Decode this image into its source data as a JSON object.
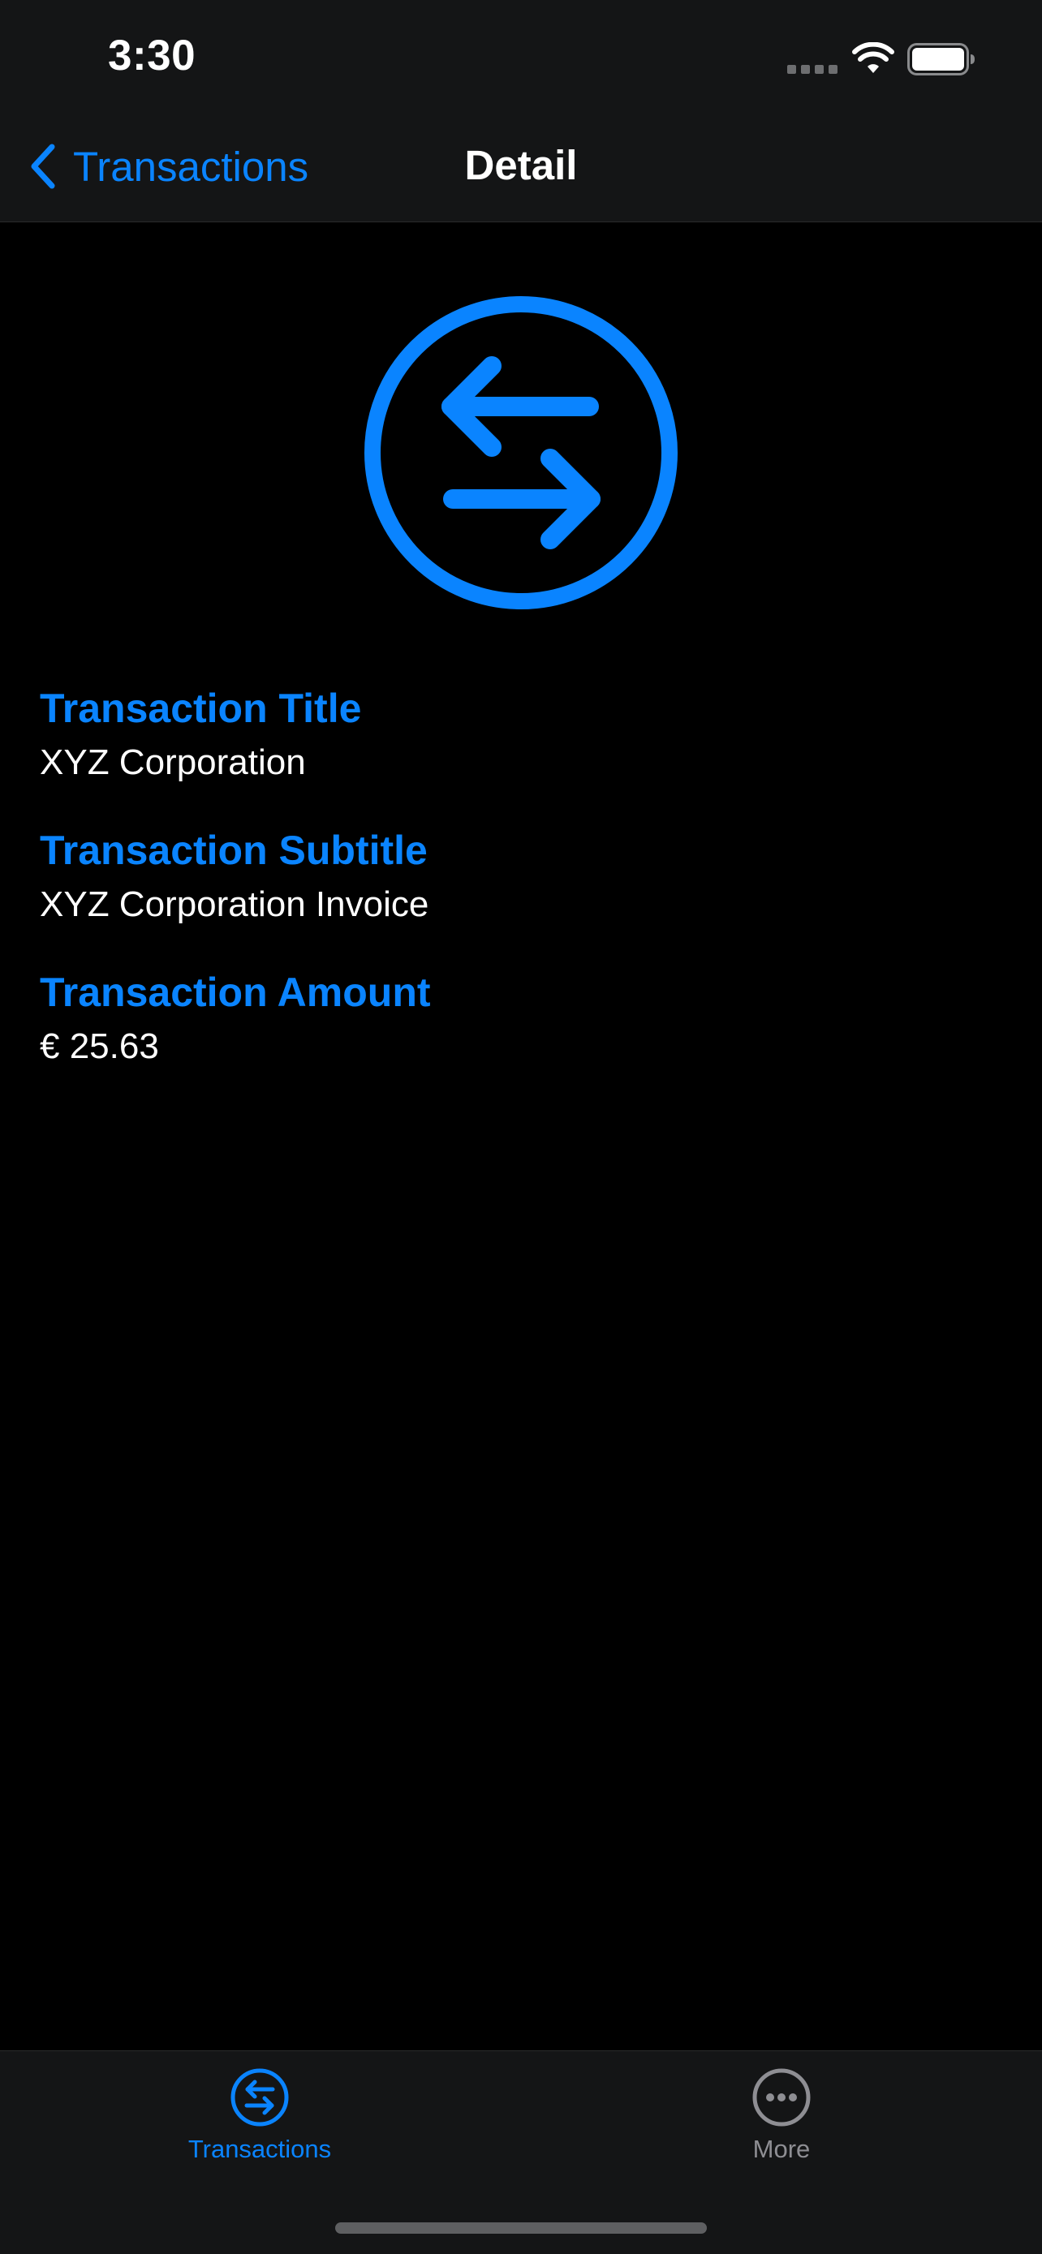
{
  "status_bar": {
    "time": "3:30"
  },
  "nav": {
    "back_label": "Transactions",
    "title": "Detail"
  },
  "hero": {
    "icon": "arrow-left-right-circle-icon"
  },
  "fields": [
    {
      "label": "Transaction Title",
      "value": "XYZ Corporation"
    },
    {
      "label": "Transaction Subtitle",
      "value": "XYZ Corporation Invoice"
    },
    {
      "label": "Transaction Amount",
      "value": "€ 25.63"
    }
  ],
  "tab_bar": {
    "tabs": [
      {
        "label": "Transactions",
        "icon": "arrow-left-right-circle-icon",
        "active": true
      },
      {
        "label": "More",
        "icon": "ellipsis-circle-icon",
        "active": false
      }
    ]
  },
  "colors": {
    "accent": "#0a84ff",
    "background": "#000000",
    "chrome": "#141516",
    "inactive": "#8e8e93"
  }
}
